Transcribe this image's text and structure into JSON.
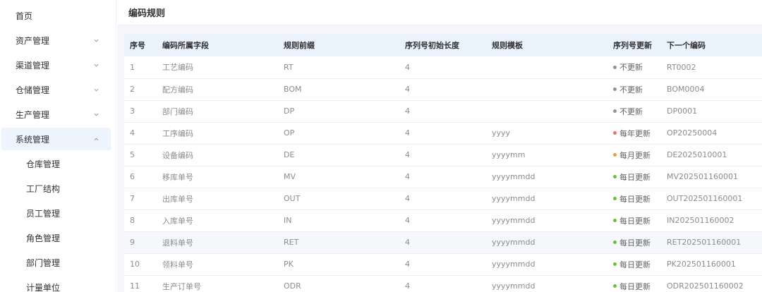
{
  "sidebar": {
    "items": [
      {
        "label": "首页",
        "expandable": false
      },
      {
        "label": "资产管理",
        "expandable": true,
        "expanded": false
      },
      {
        "label": "渠道管理",
        "expandable": true,
        "expanded": false
      },
      {
        "label": "仓储管理",
        "expandable": true,
        "expanded": false
      },
      {
        "label": "生产管理",
        "expandable": true,
        "expanded": false
      },
      {
        "label": "系统管理",
        "expandable": true,
        "expanded": true
      }
    ],
    "sub_items": [
      {
        "label": "仓库管理"
      },
      {
        "label": "工厂结构"
      },
      {
        "label": "员工管理"
      },
      {
        "label": "角色管理"
      },
      {
        "label": "部门管理"
      },
      {
        "label": "计量单位"
      }
    ]
  },
  "page": {
    "title": "编码规则"
  },
  "table": {
    "columns": [
      "序号",
      "编码所属字段",
      "规则前缀",
      "序列号初始长度",
      "规则模板",
      "序列号更新",
      "下一个编码"
    ],
    "status_colors": {
      "不更新": "#909399",
      "每年更新": "#f56c6c",
      "每月更新": "#e6a23c",
      "每日更新": "#67c23a"
    },
    "rows": [
      {
        "no": "1",
        "field": "工艺编码",
        "prefix": "RT",
        "length": "4",
        "template": "",
        "update": "不更新",
        "next": "RT0002"
      },
      {
        "no": "2",
        "field": "配方编码",
        "prefix": "BOM",
        "length": "4",
        "template": "",
        "update": "不更新",
        "next": "BOM0004"
      },
      {
        "no": "3",
        "field": "部门编码",
        "prefix": "DP",
        "length": "4",
        "template": "",
        "update": "不更新",
        "next": "DP0001"
      },
      {
        "no": "4",
        "field": "工序编码",
        "prefix": "OP",
        "length": "4",
        "template": "yyyy",
        "update": "每年更新",
        "next": "OP20250004"
      },
      {
        "no": "5",
        "field": "设备编码",
        "prefix": "DE",
        "length": "4",
        "template": "yyyymm",
        "update": "每月更新",
        "next": "DE2025010001"
      },
      {
        "no": "6",
        "field": "移库单号",
        "prefix": "MV",
        "length": "4",
        "template": "yyyymmdd",
        "update": "每日更新",
        "next": "MV202501160001"
      },
      {
        "no": "7",
        "field": "出库单号",
        "prefix": "OUT",
        "length": "4",
        "template": "yyyymmdd",
        "update": "每日更新",
        "next": "OUT202501160001"
      },
      {
        "no": "8",
        "field": "入库单号",
        "prefix": "IN",
        "length": "4",
        "template": "yyyymmdd",
        "update": "每日更新",
        "next": "IN202501160002"
      },
      {
        "no": "9",
        "field": "退料单号",
        "prefix": "RET",
        "length": "4",
        "template": "yyyymmdd",
        "update": "每日更新",
        "next": "RET202501160001"
      },
      {
        "no": "10",
        "field": "领料单号",
        "prefix": "PK",
        "length": "4",
        "template": "yyyymmdd",
        "update": "每日更新",
        "next": "PK202501160001"
      },
      {
        "no": "11",
        "field": "生产订单号",
        "prefix": "ODR",
        "length": "4",
        "template": "yyyymmdd",
        "update": "每日更新",
        "next": "ODR202501160002"
      }
    ]
  }
}
